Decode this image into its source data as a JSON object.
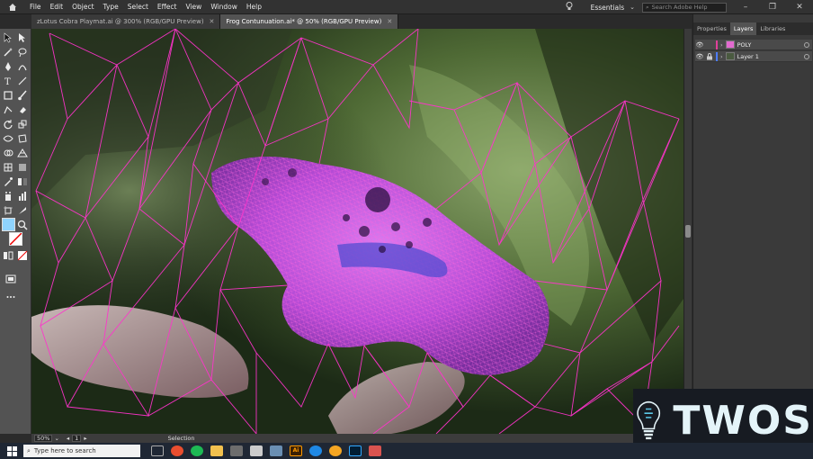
{
  "menu": {
    "items": [
      "File",
      "Edit",
      "Object",
      "Type",
      "Select",
      "Effect",
      "View",
      "Window",
      "Help"
    ],
    "workspace": "Essentials",
    "search_placeholder": "Search Adobe Help"
  },
  "tabs": [
    {
      "label": "zLotus Cobra Playmat.ai @ 300% (RGB/GPU Preview)"
    },
    {
      "label": "Frog Contunuation.ai* @ 50% (RGB/GPU Preview)"
    }
  ],
  "panel": {
    "tabs": [
      "Properties",
      "Layers",
      "Libraries"
    ],
    "layers": [
      {
        "name": "POLY",
        "color": "#e0409a"
      },
      {
        "name": "Layer 1",
        "color": "#4d7cff"
      }
    ]
  },
  "status": {
    "zoom": "50%",
    "artboard": "1",
    "tool": "Selection"
  },
  "taskbar": {
    "search_placeholder": "Type here to search",
    "app_label": "Ai"
  },
  "logo": {
    "text": "TWOS"
  },
  "colors": {
    "mesh": "#ff33cc",
    "frog": "#c050e0",
    "ui_dark": "#323232"
  }
}
